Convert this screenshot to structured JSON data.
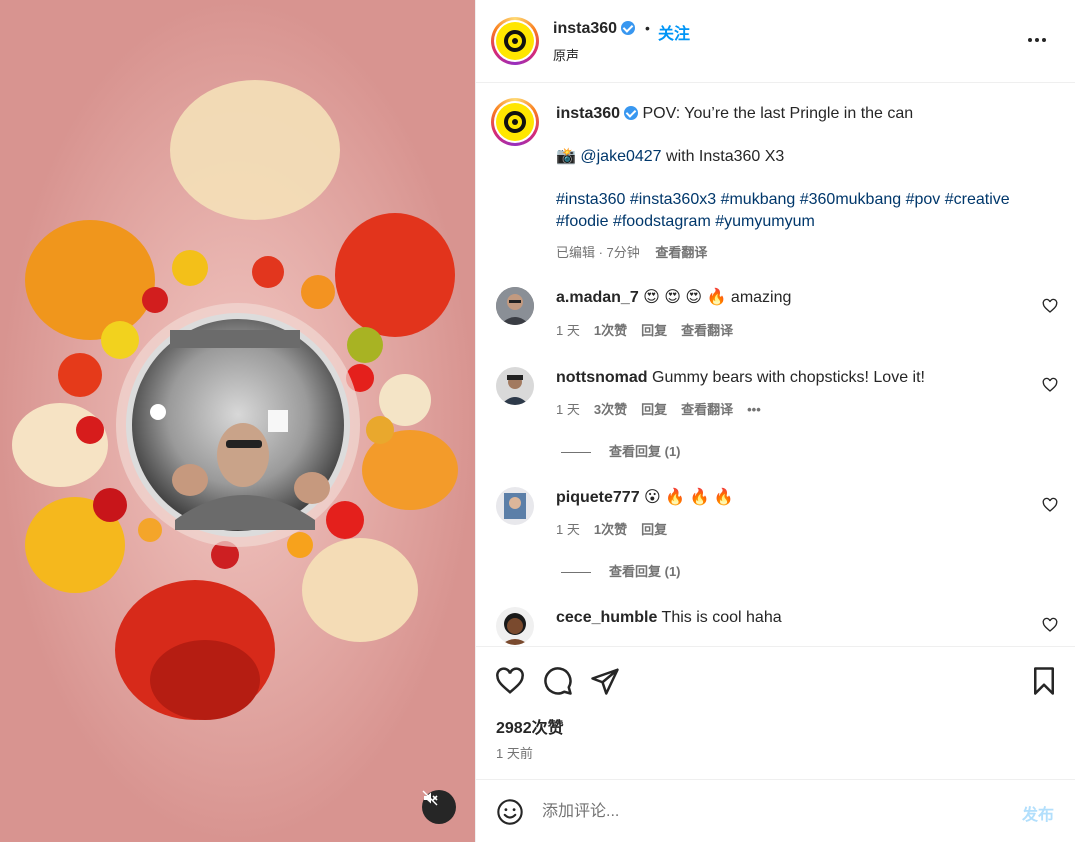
{
  "post": {
    "username": "insta360",
    "follow_label": "关注",
    "separator": "•",
    "audio_label": "原声"
  },
  "caption": {
    "username": "insta360",
    "text": "POV: You’re the last Pringle in the can",
    "camera_emoji": "📸",
    "mention": "@jake0427",
    "mention_suffix": " with Insta360 X3",
    "hashtags_line1": "#insta360 #insta360x3 #mukbang #360mukbang #pov #creative",
    "hashtags_line2": "#foodie #foodstagram #yumyumyum",
    "edited_meta": "已编辑 · 7分钟",
    "translate_label": "查看翻译"
  },
  "comments": [
    {
      "username": "a.madan_7",
      "text": "😍 😍 😍 🔥 amazing",
      "time": "1 天",
      "likes": "1次赞",
      "reply": "回复",
      "translate": "查看翻译"
    },
    {
      "username": "nottsnomad",
      "text": "Gummy bears with chopsticks! Love it!",
      "time": "1 天",
      "likes": "3次赞",
      "reply": "回复",
      "translate": "查看翻译",
      "more": "•••",
      "view_replies": "查看回复 (1)"
    },
    {
      "username": "piquete777",
      "text": "😮 🔥 🔥 🔥",
      "time": "1 天",
      "likes": "1次赞",
      "reply": "回复",
      "view_replies": "查看回复 (1)"
    },
    {
      "username": "cece_humble",
      "text": "This is cool haha"
    }
  ],
  "actions": {
    "likes_count": "2982次赞",
    "posted_time": "1 天前"
  },
  "composer": {
    "placeholder": "添加评论...",
    "post_label": "发布"
  },
  "icons": {
    "verified": "verified-badge-icon",
    "more": "more-options-icon",
    "like": "heart-icon",
    "comment": "comment-icon",
    "share": "share-icon",
    "save": "bookmark-icon",
    "emoji": "emoji-icon",
    "mute": "muted-speaker-icon"
  },
  "colors": {
    "link_blue": "#0095f6",
    "hashtag": "#00376b",
    "muted_text": "#737373",
    "post_disabled": "#b2dffc"
  }
}
